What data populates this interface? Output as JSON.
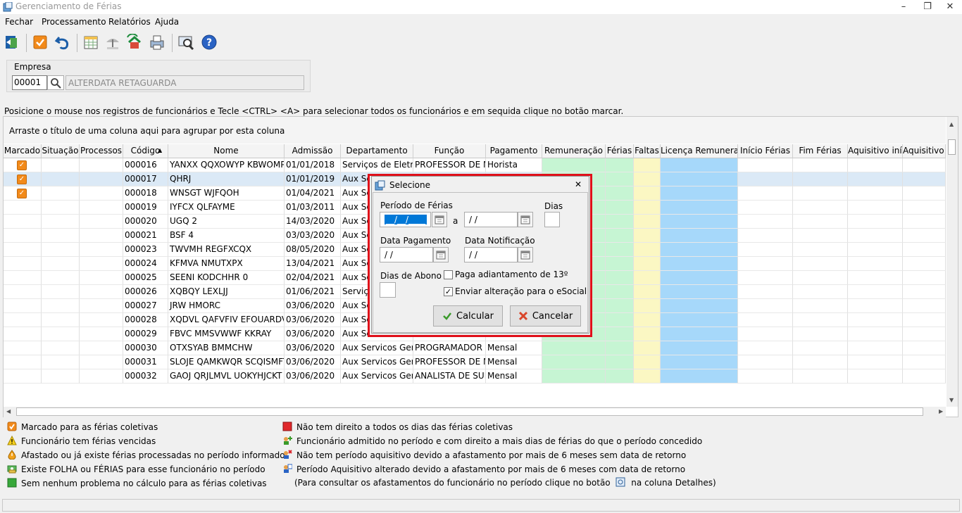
{
  "window": {
    "title": "Gerenciamento de Férias",
    "minimize": "–",
    "restore": "❐",
    "close": "✕"
  },
  "menu": [
    "Fechar",
    "Processamento",
    "Relatórios",
    "Ajuda"
  ],
  "empresa": {
    "label": "Empresa",
    "code": "00001",
    "name": "ALTERDATA RETAGUARDA"
  },
  "instruction": "Posicione o mouse nos registros de funcionários e Tecle <CTRL> <A> para selecionar todos os funcionários e em sequida clique no botão marcar.",
  "grid": {
    "group_hint": "Arraste o título de uma coluna aqui para agrupar por esta coluna",
    "sort_indicator": "▲",
    "columns": [
      "Marcado",
      "Situação",
      "Processos",
      "Código",
      "Nome",
      "Admissão",
      "Departamento",
      "Função",
      "Pagamento",
      "Remuneração",
      "Férias",
      "Faltas",
      "Licença Remunerad",
      "Início Férias",
      "Fim Férias",
      "Aquisitivo iníc",
      "Aquisitivo f"
    ],
    "rows": [
      {
        "marked": true,
        "codigo": "000016",
        "nome": "YANXX QQXOWYP KBWOMPV",
        "admissao": "01/01/2018",
        "departamento": "Serviços de Eletrôn",
        "funcao": "PROFESSOR DE MA",
        "pagamento": "Horista"
      },
      {
        "marked": true,
        "codigo": "000017",
        "nome": "QHRJ",
        "admissao": "01/01/2019",
        "departamento": "Aux Se",
        "funcao": "",
        "pagamento": ""
      },
      {
        "marked": true,
        "codigo": "000018",
        "nome": "WNSGT WJFQOH",
        "admissao": "01/04/2021",
        "departamento": "Aux Se",
        "funcao": "",
        "pagamento": ""
      },
      {
        "marked": false,
        "codigo": "000019",
        "nome": "IYFCX QLFAYME",
        "admissao": "01/03/2011",
        "departamento": "Aux Se",
        "funcao": "",
        "pagamento": ""
      },
      {
        "marked": false,
        "codigo": "000020",
        "nome": "UGQ 2",
        "admissao": "14/03/2020",
        "departamento": "Aux Se",
        "funcao": "",
        "pagamento": ""
      },
      {
        "marked": false,
        "codigo": "000021",
        "nome": "BSF 4",
        "admissao": "03/03/2020",
        "departamento": "Aux Se",
        "funcao": "",
        "pagamento": ""
      },
      {
        "marked": false,
        "codigo": "000023",
        "nome": "TWVMH REGFXCQX",
        "admissao": "08/05/2020",
        "departamento": "Aux Se",
        "funcao": "",
        "pagamento": ""
      },
      {
        "marked": false,
        "codigo": "000024",
        "nome": "KFMVA NMUTXPX",
        "admissao": "13/04/2021",
        "departamento": "Aux Se",
        "funcao": "",
        "pagamento": ""
      },
      {
        "marked": false,
        "codigo": "000025",
        "nome": "SEENI KODCHHR 0",
        "admissao": "02/04/2021",
        "departamento": "Aux Se",
        "funcao": "",
        "pagamento": ""
      },
      {
        "marked": false,
        "codigo": "000026",
        "nome": "XQBQY LEXLJJ",
        "admissao": "01/06/2021",
        "departamento": "Serviço",
        "funcao": "",
        "pagamento": ""
      },
      {
        "marked": false,
        "codigo": "000027",
        "nome": "JRW HMORC",
        "admissao": "03/06/2020",
        "departamento": "Aux Se",
        "funcao": "",
        "pagamento": ""
      },
      {
        "marked": false,
        "codigo": "000028",
        "nome": "XQDVL QAFVFIV EFOUARDVO",
        "admissao": "03/06/2020",
        "departamento": "Aux Se",
        "funcao": "",
        "pagamento": ""
      },
      {
        "marked": false,
        "codigo": "000029",
        "nome": "FBVC MMSVWWF KKRAY",
        "admissao": "03/06/2020",
        "departamento": "Aux Se",
        "funcao": "",
        "pagamento": ""
      },
      {
        "marked": false,
        "codigo": "000030",
        "nome": "OTXSYAB BMMCHW",
        "admissao": "03/06/2020",
        "departamento": "Aux Servicos Gerai",
        "funcao": "PROGRAMADOR D",
        "pagamento": "Mensal"
      },
      {
        "marked": false,
        "codigo": "000031",
        "nome": "SLOJE QAMKWQR SCQISMFTC",
        "admissao": "03/06/2020",
        "departamento": "Aux Servicos Gerai",
        "funcao": "PROFESSOR DE MA",
        "pagamento": "Mensal"
      },
      {
        "marked": false,
        "codigo": "000032",
        "nome": "GAOJ QRJLMVL UOKYHJCKT X",
        "admissao": "03/06/2020",
        "departamento": "Aux Servicos Gerai",
        "funcao": "ANALISTA DE SUP",
        "pagamento": "Mensal"
      }
    ],
    "colors": {
      "remuneracao": "#c6f5d3",
      "ferias": "#c6f5d3",
      "faltas": "#fbf7c3",
      "licenca": "#a6d8fa",
      "selected_row": "#dbe9f6"
    }
  },
  "legend_left": [
    {
      "icon": "checkbox-orange-icon",
      "text": "Marcado para as férias coletivas"
    },
    {
      "icon": "warning-icon",
      "text": "Funcionário tem férias vencidas"
    },
    {
      "icon": "alert-drop-icon",
      "text": "Afastado ou já existe férias processadas no período informado"
    },
    {
      "icon": "money-icon",
      "text": "Existe FOLHA ou FÉRIAS para esse funcionário no período"
    },
    {
      "icon": "green-square-icon",
      "text": "Sem nenhum problema no cálculo para as férias coletivas"
    }
  ],
  "legend_right": [
    {
      "icon": "red-square-icon",
      "text": "Não tem direito a todos os dias das férias coletivas"
    },
    {
      "icon": "person-plus-icon",
      "text": "Funcionário admitido no período e com direito a mais dias de férias do que o período concedido"
    },
    {
      "icon": "person-x-icon",
      "text": "Não tem período aquisitivo devido a afastamento por mais de 6 meses sem data de retorno"
    },
    {
      "icon": "person-calendar-icon",
      "text": "Período Aquisitivo alterado devido a afastamento por mais de 6 meses com data de retorno"
    }
  ],
  "legend_note": {
    "before": "(Para consultar os afastamentos do funcionário no período clique no botão",
    "after": "na coluna Detalhes)"
  },
  "dialog": {
    "title": "Selecione",
    "periodo_label": "Período de Férias",
    "periodo_start": "__/__/____",
    "periodo_sep": "a",
    "periodo_end": " /  /",
    "dias_label": "Dias",
    "dias_value": "",
    "pagamento_label": "Data Pagamento",
    "pagamento_value": " /  /",
    "notificacao_label": "Data Notificação",
    "notificacao_value": " /  /",
    "abono_label": "Dias de Abono",
    "abono_value": "",
    "adiantamento_label": "Paga adiantamento de 13º",
    "adiantamento_checked": false,
    "esocial_label": "Enviar alteração para o eSocial",
    "esocial_checked": true,
    "calcular_label": "Calcular",
    "cancelar_label": "Cancelar"
  }
}
